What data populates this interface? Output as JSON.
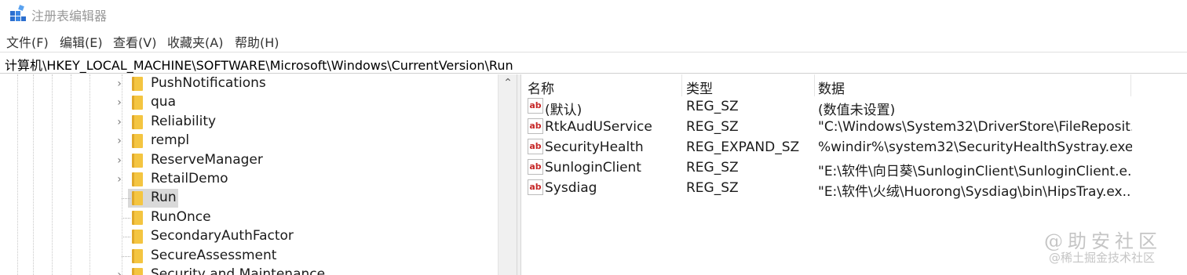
{
  "window": {
    "title": "注册表编辑器"
  },
  "menu": [
    {
      "label": "文件(F)"
    },
    {
      "label": "编辑(E)"
    },
    {
      "label": "查看(V)"
    },
    {
      "label": "收藏夹(A)"
    },
    {
      "label": "帮助(H)"
    }
  ],
  "address": {
    "path": "计算机\\HKEY_LOCAL_MACHINE\\SOFTWARE\\Microsoft\\Windows\\CurrentVersion\\Run"
  },
  "tree": {
    "items": [
      {
        "label": "PushNotifications",
        "expandable": true
      },
      {
        "label": "qua",
        "expandable": true
      },
      {
        "label": "Reliability",
        "expandable": true
      },
      {
        "label": "rempl",
        "expandable": true
      },
      {
        "label": "ReserveManager",
        "expandable": true
      },
      {
        "label": "RetailDemo",
        "expandable": true
      },
      {
        "label": "Run",
        "expandable": false,
        "selected": true
      },
      {
        "label": "RunOnce",
        "expandable": false
      },
      {
        "label": "SecondaryAuthFactor",
        "expandable": false
      },
      {
        "label": "SecureAssessment",
        "expandable": false
      },
      {
        "label": "Security and Maintenance",
        "expandable": true
      }
    ]
  },
  "list": {
    "columns": {
      "name": "名称",
      "type": "类型",
      "data": "数据"
    },
    "rows": [
      {
        "name": "(默认)",
        "type": "REG_SZ",
        "data": "(数值未设置)",
        "icon": "string-value-icon"
      },
      {
        "name": "RtkAudUService",
        "type": "REG_SZ",
        "data": "\"C:\\Windows\\System32\\DriverStore\\FileReposit...",
        "icon": "string-value-icon"
      },
      {
        "name": "SecurityHealth",
        "type": "REG_EXPAND_SZ",
        "data": "%windir%\\system32\\SecurityHealthSystray.exe",
        "icon": "string-value-icon"
      },
      {
        "name": "SunloginClient",
        "type": "REG_SZ",
        "data": "\"E:\\软件\\向日葵\\SunloginClient\\SunloginClient.e...",
        "icon": "string-value-icon"
      },
      {
        "name": "Sysdiag",
        "type": "REG_SZ",
        "data": "\"E:\\软件\\火绒\\Huorong\\Sysdiag\\bin\\HipsTray.ex...",
        "icon": "string-value-icon"
      }
    ]
  },
  "watermark": {
    "line1": "@助安社区",
    "line2": "@稀土掘金技术社区"
  },
  "colors": {
    "selection": "#d9d9d9",
    "folder": "#f4c541",
    "string_icon_text": "#c62828"
  }
}
